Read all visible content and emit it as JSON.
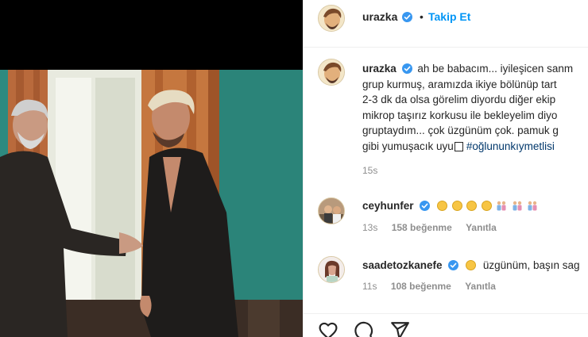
{
  "header": {
    "username": "urazka",
    "follow_label": "Takip Et",
    "separator": "•"
  },
  "caption": {
    "username": "urazka",
    "lines": [
      "ah be babacım... iyileşicen sanm",
      "grup kurmuş, aramızda ikiye bölünüp tart",
      "2-3 dk da olsa görelim diyordu diğer ekip",
      "mikrop taşırız korkusu ile bekleyelim diyo",
      "gruptaydım... çok üzgünüm çok. pamuk g",
      "gibi yumuşacık uyu"
    ],
    "hashtag": "#oğlununkıymetlisi",
    "time": "15s"
  },
  "comments": [
    {
      "username": "ceyhunfer",
      "emojis": [
        "sad-face",
        "sad-face",
        "sad-face",
        "sad-face",
        "family",
        "family",
        "family"
      ],
      "time": "13s",
      "likes": "158 beğenme",
      "reply": "Yanıtla"
    },
    {
      "username": "saadetozkanefe",
      "text": "üzgünüm, başın sag",
      "time": "11s",
      "likes": "108 beğenme",
      "reply": "Yanıtla"
    }
  ],
  "colors": {
    "accent": "#0095f6",
    "verified": "#3897f0",
    "hashtag": "#00376b",
    "muted": "#8e8e8e"
  }
}
